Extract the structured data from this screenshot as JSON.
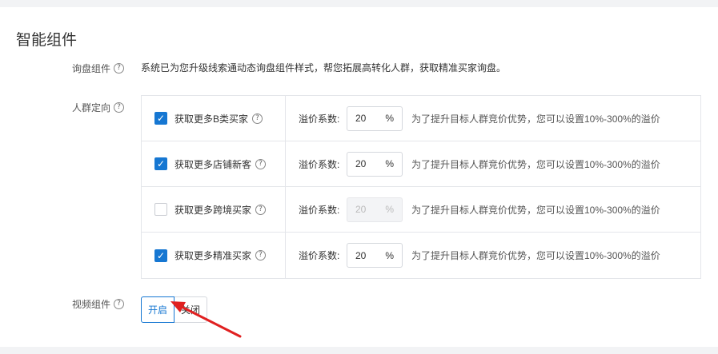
{
  "section": {
    "title": "智能组件"
  },
  "inquiry": {
    "label": "询盘组件",
    "help": "?",
    "description": "系统已为您升级线索通动态询盘组件样式，帮您拓展高转化人群，获取精准买家询盘。"
  },
  "crowd": {
    "label": "人群定向",
    "help": "?",
    "ratio_label": "溢价系数:",
    "unit": "%",
    "hint": "为了提升目标人群竞价优势，您可以设置10%-300%的溢价",
    "rows": [
      {
        "label": "获取更多B类买家",
        "checked": true,
        "value": "20"
      },
      {
        "label": "获取更多店铺新客",
        "checked": true,
        "value": "20"
      },
      {
        "label": "获取更多跨境买家",
        "checked": false,
        "value": "20"
      },
      {
        "label": "获取更多精准买家",
        "checked": true,
        "value": "20"
      }
    ]
  },
  "video": {
    "label": "视频组件",
    "help": "?",
    "on_label": "开启",
    "off_label": "关闭",
    "selected": "开启"
  },
  "colors": {
    "accent": "#1677d2",
    "arrow": "#e02020"
  }
}
